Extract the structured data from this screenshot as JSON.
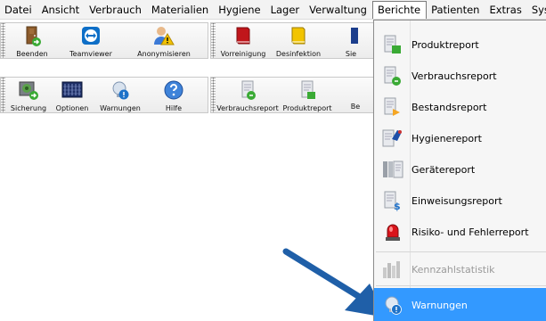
{
  "menubar": {
    "items": [
      "Datei",
      "Ansicht",
      "Verbrauch",
      "Materialien",
      "Hygiene",
      "Lager",
      "Verwaltung",
      "Berichte",
      "Patienten",
      "Extras",
      "Syst"
    ],
    "active_index": 7
  },
  "toolbar_row1": {
    "group1": [
      {
        "label": "Beenden",
        "icon": "door-exit-icon"
      },
      {
        "label": "Teamviewer",
        "icon": "teamviewer-icon"
      },
      {
        "label": "Anonymisieren",
        "icon": "anonymize-user-icon"
      }
    ],
    "group2": [
      {
        "label": "Vorreinigung",
        "icon": "red-book-icon"
      },
      {
        "label": "Desinfektion",
        "icon": "yellow-book-icon"
      },
      {
        "label": "Sie",
        "icon": "sterilization-icon"
      }
    ]
  },
  "toolbar_row2": {
    "group1": [
      {
        "label": "Sicherung",
        "icon": "backup-icon"
      },
      {
        "label": "Optionen",
        "icon": "options-grid-icon"
      },
      {
        "label": "Warnungen",
        "icon": "warning-bulb-icon"
      },
      {
        "label": "Hilfe",
        "icon": "help-icon"
      }
    ],
    "group2": [
      {
        "label": "Verbrauchsreport",
        "icon": "report-icon"
      },
      {
        "label": "Produktreport",
        "icon": "report-icon"
      },
      {
        "label": "Be",
        "icon": "report-icon"
      }
    ]
  },
  "dropdown": {
    "items": [
      {
        "label": "Produktreport",
        "icon": "product-report-icon",
        "disabled": false
      },
      {
        "label": "Verbrauchsreport",
        "icon": "consumption-report-icon",
        "disabled": false
      },
      {
        "label": "Bestandsreport",
        "icon": "stock-report-icon",
        "disabled": false
      },
      {
        "label": "Hygienereport",
        "icon": "hygiene-report-icon",
        "disabled": false
      },
      {
        "label": "Gerätereport",
        "icon": "device-report-icon",
        "disabled": false
      },
      {
        "label": "Einweisungsreport",
        "icon": "instruction-report-icon",
        "disabled": false
      },
      {
        "label": "Risiko- und Fehlerreport",
        "icon": "alarm-light-icon",
        "disabled": false
      },
      {
        "label": "Kennzahlstatistik",
        "icon": "statistics-icon",
        "disabled": true
      },
      {
        "label": "Warnungen",
        "icon": "warning-bulb-icon",
        "disabled": false,
        "highlighted": true
      }
    ]
  },
  "colors": {
    "highlight": "#3399ff",
    "arrow": "#1f5fa8"
  }
}
